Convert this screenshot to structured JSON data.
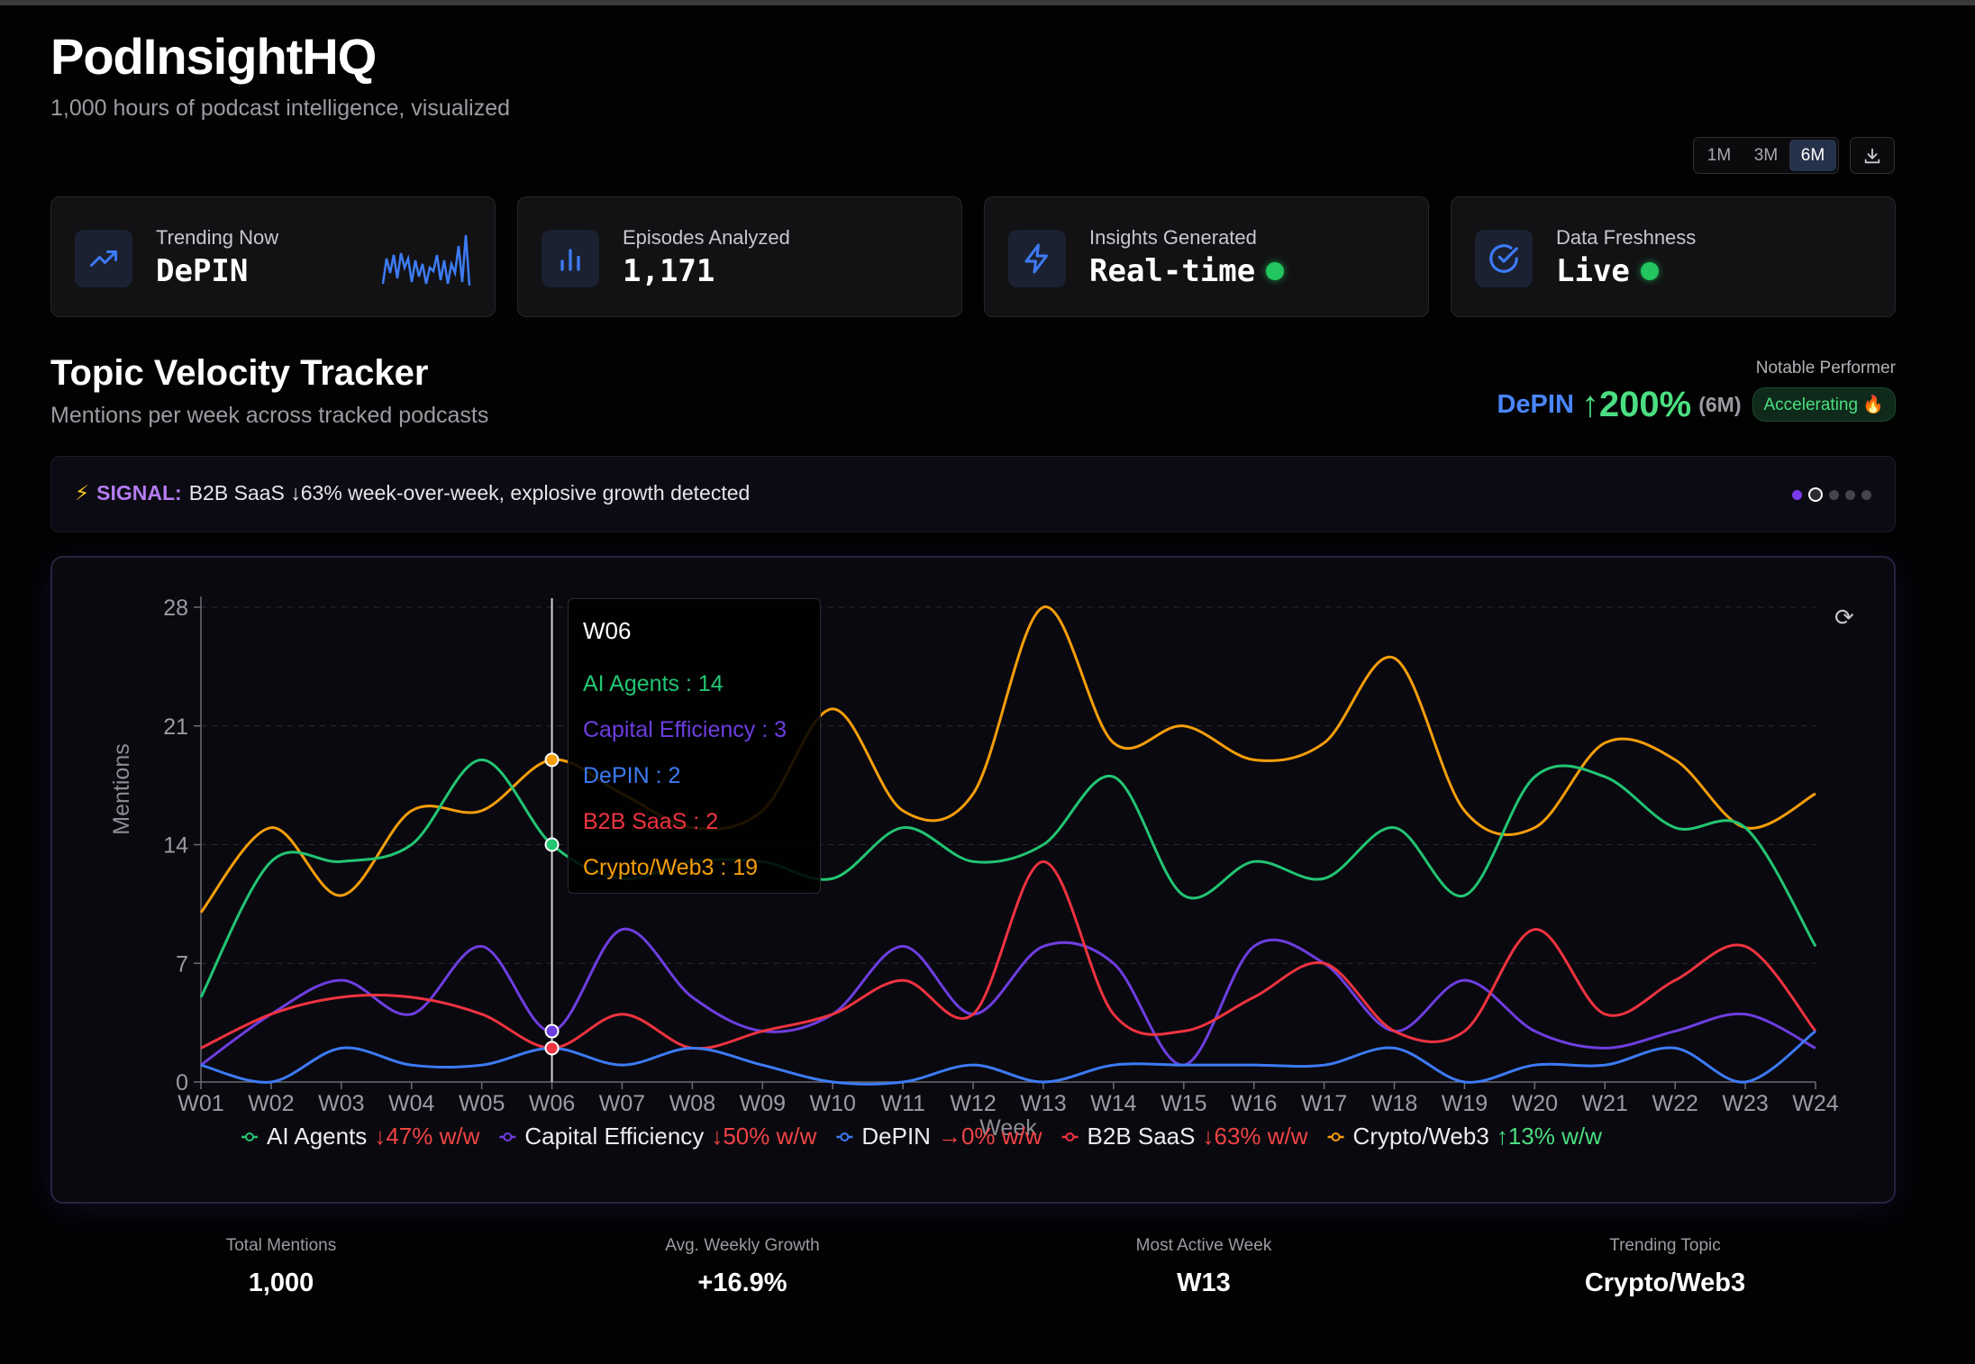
{
  "app": {
    "title": "PodInsightHQ",
    "subtitle": "1,000 hours of podcast intelligence, visualized"
  },
  "controls": {
    "ranges": [
      "1M",
      "3M",
      "6M"
    ],
    "active_range": "6M",
    "download_icon": "download-icon"
  },
  "cards": [
    {
      "label": "Trending Now",
      "value": "DePIN",
      "icon": "trending-up-icon",
      "has_sparkline": true
    },
    {
      "label": "Episodes Analyzed",
      "value": "1,171",
      "icon": "bar-chart-icon"
    },
    {
      "label": "Insights Generated",
      "value": "Real-time",
      "icon": "lightning-icon",
      "status": "live"
    },
    {
      "label": "Data Freshness",
      "value": "Live",
      "icon": "check-circle-icon",
      "status": "live"
    }
  ],
  "section": {
    "title": "Topic Velocity Tracker",
    "subtitle": "Mentions per week across tracked podcasts"
  },
  "notable": {
    "label": "Notable Performer",
    "topic": "DePIN",
    "change": "↑200%",
    "period": "(6M)",
    "badge": "Accelerating 🔥"
  },
  "signal": {
    "icon": "⚡",
    "label": "SIGNAL:",
    "text": "B2B SaaS ↓63% week-over-week, explosive growth detected",
    "dots": 5,
    "active_dot": 1
  },
  "tooltip": {
    "title": "W06",
    "rows": [
      {
        "text": "AI Agents : 14",
        "color": "#22c573"
      },
      {
        "text": "Capital Efficiency : 3",
        "color": "#6d3ee0"
      },
      {
        "text": "DePIN : 2",
        "color": "#3d7bf6"
      },
      {
        "text": "B2B SaaS : 2",
        "color": "#ef3340"
      },
      {
        "text": "Crypto/Web3 : 19",
        "color": "#f59e0b"
      }
    ]
  },
  "chart_data": {
    "type": "line",
    "xlabel": "Week",
    "ylabel": "Mentions",
    "ylim": [
      0,
      28
    ],
    "yticks": [
      0,
      7,
      14,
      21,
      28
    ],
    "x": [
      "W01",
      "W02",
      "W03",
      "W04",
      "W05",
      "W06",
      "W07",
      "W08",
      "W09",
      "W10",
      "W11",
      "W12",
      "W13",
      "W14",
      "W15",
      "W16",
      "W17",
      "W18",
      "W19",
      "W20",
      "W21",
      "W22",
      "W23",
      "W24"
    ],
    "highlight_x": "W06",
    "legend_position": "bottom",
    "series": [
      {
        "name": "AI Agents",
        "color": "#22c573",
        "change": "↓47% w/w",
        "change_color": "#ef4444",
        "values": [
          5,
          13,
          13,
          14,
          19,
          14,
          12,
          13,
          13,
          12,
          15,
          13,
          14,
          18,
          11,
          13,
          12,
          15,
          11,
          18,
          18,
          15,
          15,
          8
        ]
      },
      {
        "name": "Capital Efficiency",
        "color": "#6d3ee0",
        "change": "↓50% w/w",
        "change_color": "#ef4444",
        "values": [
          1,
          4,
          6,
          4,
          8,
          3,
          9,
          5,
          3,
          4,
          8,
          4,
          8,
          7,
          1,
          8,
          7,
          3,
          6,
          3,
          2,
          3,
          4,
          2
        ]
      },
      {
        "name": "DePIN",
        "color": "#3d7bf6",
        "change": "→0% w/w",
        "change_color": "#ef4444",
        "values": [
          1,
          0,
          2,
          1,
          1,
          2,
          1,
          2,
          1,
          0,
          0,
          1,
          0,
          1,
          1,
          1,
          1,
          2,
          0,
          1,
          1,
          2,
          0,
          3
        ]
      },
      {
        "name": "B2B SaaS",
        "color": "#ef3340",
        "change": "↓63% w/w",
        "change_color": "#ef4444",
        "values": [
          2,
          4,
          5,
          5,
          4,
          2,
          4,
          2,
          3,
          4,
          6,
          4,
          13,
          4,
          3,
          5,
          7,
          3,
          3,
          9,
          4,
          6,
          8,
          3
        ]
      },
      {
        "name": "Crypto/Web3",
        "color": "#f59e0b",
        "change": "↑13% w/w",
        "change_color": "#4ade80",
        "values": [
          10,
          15,
          11,
          16,
          16,
          19,
          17,
          15,
          16,
          22,
          16,
          17,
          28,
          20,
          21,
          19,
          20,
          25,
          16,
          15,
          20,
          19,
          15,
          17
        ]
      }
    ]
  },
  "stats": [
    {
      "label": "Total Mentions",
      "value": "1,000"
    },
    {
      "label": "Avg. Weekly Growth",
      "value": "+16.9%"
    },
    {
      "label": "Most Active Week",
      "value": "W13"
    },
    {
      "label": "Trending Topic",
      "value": "Crypto/Web3"
    }
  ]
}
